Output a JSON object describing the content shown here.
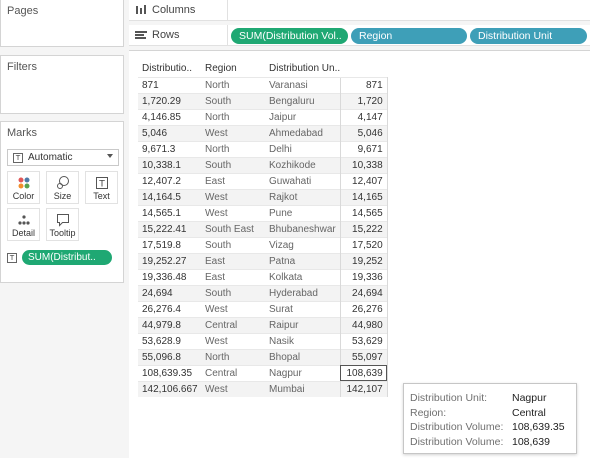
{
  "panes": {
    "pages_title": "Pages",
    "filters_title": "Filters",
    "marks_title": "Marks"
  },
  "marks": {
    "type_label": "Automatic",
    "buttons": {
      "color": "Color",
      "size": "Size",
      "text": "Text",
      "detail": "Detail",
      "tooltip": "Tooltip"
    },
    "pill_label": "SUM(Distribut.."
  },
  "shelves": {
    "columns_label": "Columns",
    "rows_label": "Rows",
    "row_pills": [
      "SUM(Distribution Vol..",
      "Region",
      "Distribution Unit"
    ]
  },
  "table": {
    "headers": [
      "Distributio..",
      "Region",
      "Distribution Un.."
    ],
    "rows": [
      [
        "871",
        "North",
        "Varanasi",
        "871"
      ],
      [
        "1,720.29",
        "South",
        "Bengaluru",
        "1,720"
      ],
      [
        "4,146.85",
        "North",
        "Jaipur",
        "4,147"
      ],
      [
        "5,046",
        "West",
        "Ahmedabad",
        "5,046"
      ],
      [
        "9,671.3",
        "North",
        "Delhi",
        "9,671"
      ],
      [
        "10,338.1",
        "South",
        "Kozhikode",
        "10,338"
      ],
      [
        "12,407.2",
        "East",
        "Guwahati",
        "12,407"
      ],
      [
        "14,164.5",
        "West",
        "Rajkot",
        "14,165"
      ],
      [
        "14,565.1",
        "West",
        "Pune",
        "14,565"
      ],
      [
        "15,222.41",
        "South East",
        "Bhubaneshwar",
        "15,222"
      ],
      [
        "17,519.8",
        "South",
        "Vizag",
        "17,520"
      ],
      [
        "19,252.27",
        "East",
        "Patna",
        "19,252"
      ],
      [
        "19,336.48",
        "East",
        "Kolkata",
        "19,336"
      ],
      [
        "24,694",
        "South",
        "Hyderabad",
        "24,694"
      ],
      [
        "26,276.4",
        "West",
        "Surat",
        "26,276"
      ],
      [
        "44,979.8",
        "Central",
        "Raipur",
        "44,980"
      ],
      [
        "53,628.9",
        "West",
        "Nasik",
        "53,629"
      ],
      [
        "55,096.8",
        "North",
        "Bhopal",
        "55,097"
      ],
      [
        "108,639.35",
        "Central",
        "Nagpur",
        "108,639"
      ],
      [
        "142,106.667",
        "West",
        "Mumbai",
        "142,107"
      ]
    ]
  },
  "tooltip": {
    "rows": [
      {
        "key": "Distribution Unit:",
        "value": "Nagpur"
      },
      {
        "key": "Region:",
        "value": "Central"
      },
      {
        "key": "Distribution Volume:",
        "value": "108,639.35"
      },
      {
        "key": "Distribution Volume:",
        "value": "108,639"
      }
    ]
  },
  "colors": {
    "measure_pill": "#1fa873",
    "dimension_pill": "#3e9fb8"
  }
}
